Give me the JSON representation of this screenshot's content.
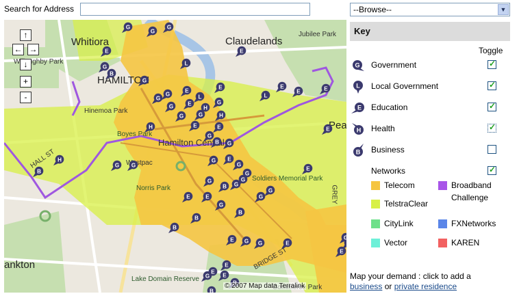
{
  "search": {
    "label": "Search for Address",
    "value": "",
    "placeholder": ""
  },
  "browse": {
    "selected": "--Browse--"
  },
  "map": {
    "nav": {
      "up": "↑",
      "left": "←",
      "right": "→",
      "down": "↓",
      "zoom_in": "+",
      "zoom_out": "-"
    },
    "labels": {
      "whitiora": "Whitiora",
      "claudelands": "Claudelands",
      "jubilee_park": "Jubilee Park",
      "willoughby_park": "Willoughby Park",
      "hamilton": "HAMILTON",
      "hinemoa_park": "Hinemoa Park",
      "boyes_park": "Boyes Park",
      "hamilton_central": "Hamilton Central",
      "hall_st": "HALL ST",
      "westpac": "Westpac",
      "norris_park": "Norris Park",
      "soldiers_memorial_park": "Soldiers Memorial Park",
      "peac": "Peac",
      "frankton": "ankton",
      "lake_domain_reserve": "Lake Domain Reserve",
      "grey": "GREY",
      "bridge_st": "BRIDGE ST",
      "commerce_park": "Commerce Park"
    },
    "copyright": "© 2007 Map data Terralink"
  },
  "key": {
    "title": "Key",
    "toggle_label": "Toggle",
    "categories": [
      {
        "label": "Government",
        "icon": "government-marker-icon",
        "checked": true
      },
      {
        "label": "Local Government",
        "icon": "local-government-marker-icon",
        "checked": true
      },
      {
        "label": "Education",
        "icon": "education-marker-icon",
        "checked": true
      },
      {
        "label": "Health",
        "icon": "health-marker-icon",
        "checked": true
      },
      {
        "label": "Business",
        "icon": "business-marker-icon",
        "checked": false
      },
      {
        "label": "Networks",
        "icon": "",
        "checked": true
      }
    ],
    "networks": [
      {
        "label": "Telecom",
        "color": "#f5c542"
      },
      {
        "label": "Broadband",
        "label2": "Challenge",
        "color": "#a855e8"
      },
      {
        "label": "TelstraClear",
        "color": "#d8f046"
      },
      {
        "label": "CityLink",
        "color": "#6ee08a"
      },
      {
        "label": "FXNetworks",
        "color": "#5b86e8"
      },
      {
        "label": "Vector",
        "color": "#6ef0d8"
      },
      {
        "label": "KAREN",
        "color": "#f26161"
      }
    ]
  },
  "demand": {
    "text": "Map your demand : click to add a",
    "business_link": "business",
    "or": "or",
    "residence_link": "private residence"
  },
  "colors": {
    "telecom": "#f5c542",
    "telstraclear": "#d8f046",
    "marker": "#3b3a6e",
    "park": "#b9d7a0"
  }
}
